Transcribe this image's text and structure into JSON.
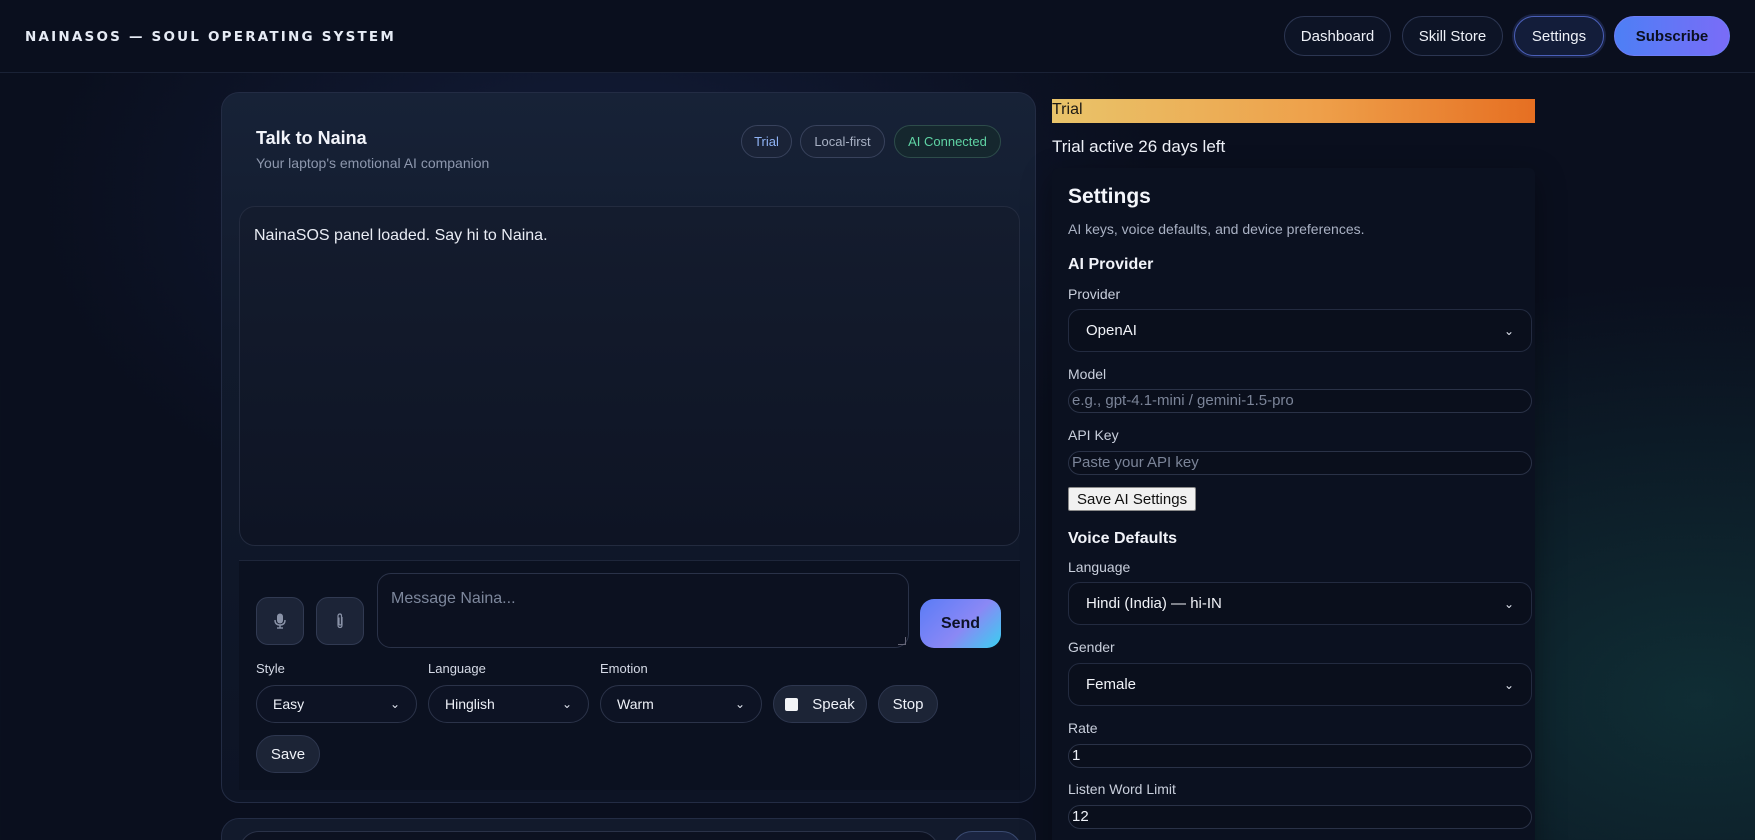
{
  "header": {
    "brand": "NAINASOS — SOUL OPERATING SYSTEM",
    "nav": {
      "dashboard": "Dashboard",
      "skill_store": "Skill Store",
      "settings": "Settings",
      "subscribe": "Subscribe"
    }
  },
  "chat": {
    "title": "Talk to Naina",
    "subtitle": "Your laptop's emotional AI companion",
    "badges": {
      "trial": "Trial",
      "local": "Local-first",
      "connected": "AI Connected"
    },
    "transcript_message": "NainaSOS panel loaded. Say hi to Naina.",
    "mic_icon": "microphone-icon",
    "attach_icon": "paperclip-icon",
    "message_placeholder": "Message Naina...",
    "send_label": "Send",
    "style": {
      "label": "Style",
      "value": "Easy"
    },
    "language": {
      "label": "Language",
      "value": "Hinglish"
    },
    "emotion": {
      "label": "Emotion",
      "value": "Warm"
    },
    "speak_label": "Speak",
    "stop_label": "Stop",
    "save_label": "Save"
  },
  "trial": {
    "bar_label": "Trial",
    "status": "Trial active 26 days left"
  },
  "settings": {
    "title": "Settings",
    "subtitle": "AI keys, voice defaults, and device preferences.",
    "ai_provider": {
      "heading": "AI Provider",
      "provider_label": "Provider",
      "provider_value": "OpenAI",
      "model_label": "Model",
      "model_placeholder": "e.g., gpt-4.1-mini / gemini-1.5-pro",
      "api_key_label": "API Key",
      "api_key_placeholder": "Paste your API key",
      "save_label": "Save AI Settings"
    },
    "voice_defaults": {
      "heading": "Voice Defaults",
      "language_label": "Language",
      "language_value": "Hindi (India) — hi-IN",
      "gender_label": "Gender",
      "gender_value": "Female",
      "rate_label": "Rate",
      "rate_value": "1",
      "listen_limit_label": "Listen Word Limit",
      "listen_limit_value": "12"
    }
  },
  "colors": {
    "background": "#0a0f1e",
    "accent": "#5a7cf7",
    "connected": "#5fd3a4",
    "trial_gradient_start": "#e9c46a",
    "trial_gradient_end": "#e66f22"
  }
}
